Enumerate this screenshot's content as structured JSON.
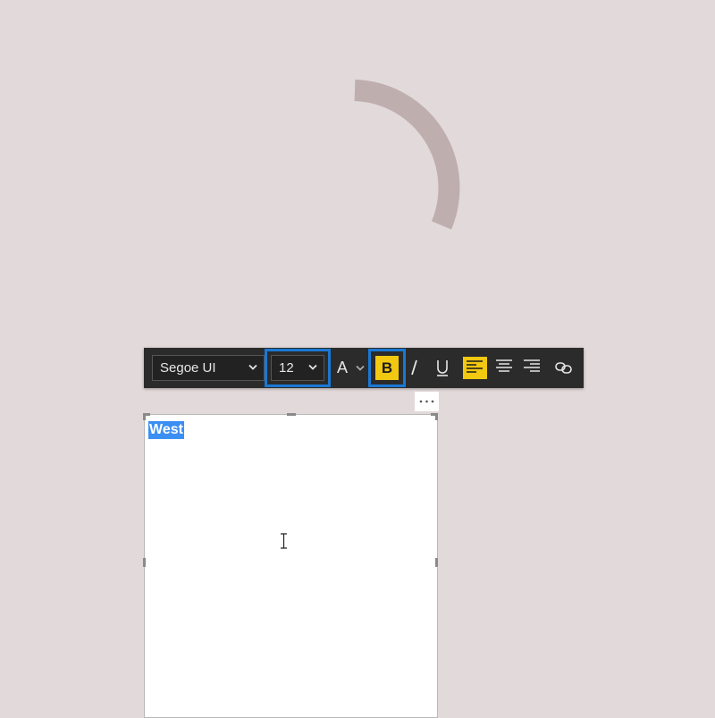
{
  "toolbar": {
    "font_family": "Segoe UI",
    "font_size": "12",
    "font_color_glyph": "A",
    "bold_glyph": "B",
    "bold_active": true,
    "alignment_active": "left"
  },
  "textbox": {
    "selected_text": "West"
  },
  "icons": {
    "chevron": "chevron-down-icon",
    "italic": "italic-icon",
    "underline": "underline-icon",
    "align_left": "align-left-icon",
    "align_center": "align-center-icon",
    "align_right": "align-right-icon",
    "link": "link-icon",
    "more": "more-options-icon",
    "cursor": "text-cursor-icon",
    "spinner": "loading-spinner-icon"
  },
  "colors": {
    "canvas_bg": "#e2d9da",
    "toolbar_bg": "#2b2b2b",
    "highlight_border": "#1a78d4",
    "active_yellow": "#f2c811",
    "selection": "#3b8ff2",
    "spinner": "#bfaeae"
  }
}
